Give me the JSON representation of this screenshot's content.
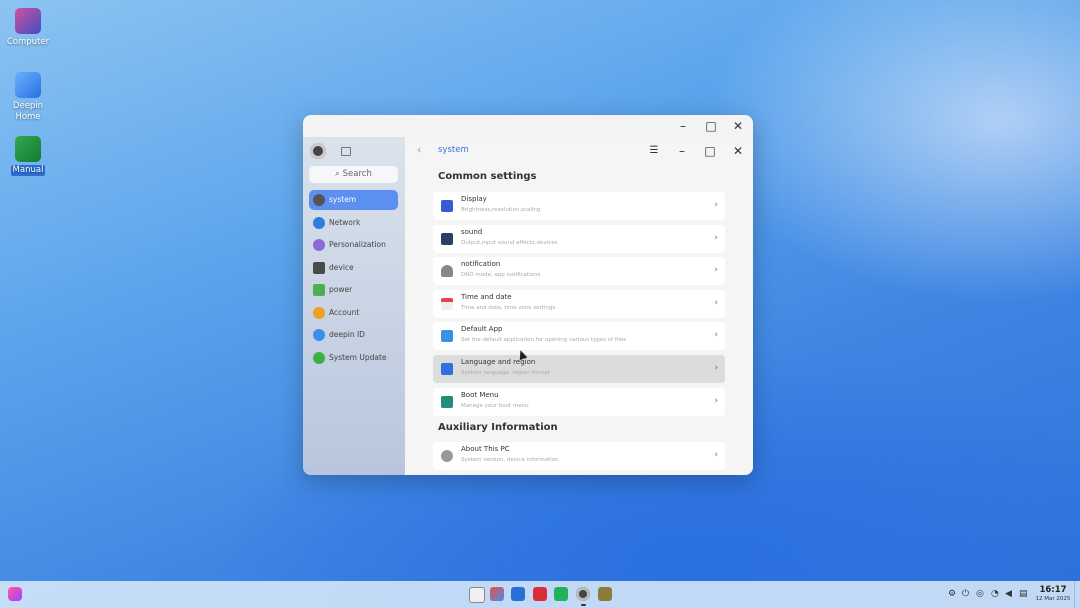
{
  "desktop": {
    "icons": [
      {
        "label": "Computer"
      },
      {
        "label": "Deepin Home"
      },
      {
        "label": "Manual"
      }
    ]
  },
  "sidebar": {
    "search_placeholder": "Search",
    "items": [
      {
        "label": "system",
        "icon": "system-icon",
        "color": "#555555"
      },
      {
        "label": "Network",
        "icon": "network-icon",
        "color": "#2f7de1"
      },
      {
        "label": "Personalization",
        "icon": "personalization-icon",
        "color": "#8a6bd6"
      },
      {
        "label": "device",
        "icon": "device-icon",
        "color": "#4a4a4a"
      },
      {
        "label": "power",
        "icon": "power-icon",
        "color": "#4caf50"
      },
      {
        "label": "Account",
        "icon": "account-icon",
        "color": "#f0a020"
      },
      {
        "label": "deepin ID",
        "icon": "cloud-icon",
        "color": "#3a8fe8"
      },
      {
        "label": "System Update",
        "icon": "update-icon",
        "color": "#3cb043"
      }
    ]
  },
  "main": {
    "title": "system",
    "sections": [
      {
        "heading": "Common settings",
        "cards": [
          {
            "title": "Display",
            "subtitle": "Brightness,resolution,scaling",
            "icon": "display-icon",
            "color": "#3a5bd6"
          },
          {
            "title": "sound",
            "subtitle": "Output,input sound effects,devices",
            "icon": "sound-icon",
            "color": "#2c3e66"
          },
          {
            "title": "notification",
            "subtitle": "DND mode, app notifications",
            "icon": "bell-icon",
            "color": "#888888"
          },
          {
            "title": "Time and date",
            "subtitle": "Time and date, time zone settings",
            "icon": "calendar-icon",
            "color": "#e04848"
          },
          {
            "title": "Default App",
            "subtitle": "Set the default application for opening various types of files",
            "icon": "default-app-icon",
            "color": "#3a8fe8"
          },
          {
            "title": "Language and region",
            "subtitle": "System language, region format",
            "icon": "language-icon",
            "color": "#2f6fe0"
          },
          {
            "title": "Boot Menu",
            "subtitle": "Manage your boot menu",
            "icon": "boot-icon",
            "color": "#1f8f7a"
          }
        ]
      },
      {
        "heading": "Auxiliary Information",
        "cards": [
          {
            "title": "About This PC",
            "subtitle": "System version, device information",
            "icon": "info-icon",
            "color": "#999999"
          }
        ]
      }
    ]
  },
  "taskbar": {
    "clock_time": "16:17",
    "clock_date": "12 Mar 2025"
  }
}
